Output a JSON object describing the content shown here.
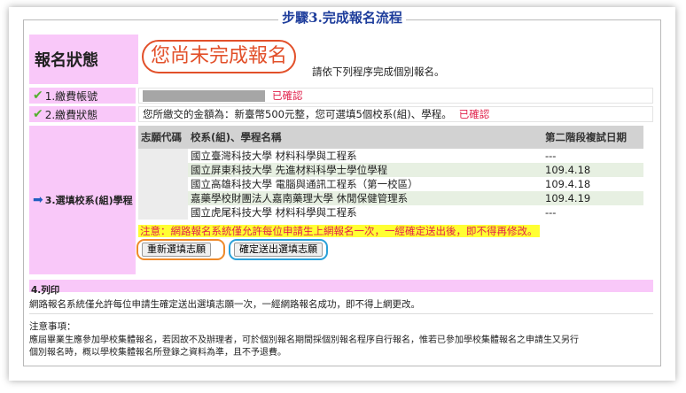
{
  "page": {
    "step_title": "步驟3.完成報名流程"
  },
  "status": {
    "label": "報名狀態",
    "headline": "您尚未完成報名",
    "note": "請依下列程序完成個別報名。"
  },
  "account": {
    "label": "1.繳費帳號",
    "confirmed": "已確認"
  },
  "payment": {
    "label": "2.繳費狀態",
    "text": "您所繳交的金額為：新臺幣500元整，您可選填5個校系(組)、學程。",
    "confirmed": "已確認"
  },
  "choices": {
    "label": "3.選填校系(組)學程",
    "columns": [
      "志願代碼",
      "校系(組)、學程名稱",
      "第二階段複試日期"
    ],
    "rows": [
      {
        "code": "",
        "name": "國立臺灣科技大學 材料科學與工程系",
        "date": "---"
      },
      {
        "code": "",
        "name": "國立屏東科技大學 先進材料科學士學位學程",
        "date": "109.4.18"
      },
      {
        "code": "",
        "name": "國立高雄科技大學 電腦與通訊工程系（第一校區）",
        "date": "109.4.18"
      },
      {
        "code": "",
        "name": "嘉藥學校財團法人嘉南藥理大學 休閒保健管理系",
        "date": "109.4.19"
      },
      {
        "code": "",
        "name": "國立虎尾科技大學 材料科學與工程系",
        "date": "---"
      }
    ],
    "warning": "注意：網路報名系統僅允許每位申請生上網報名一次，一經確定送出後，即不得再修改。",
    "reselect_button": "重新選填志願",
    "confirm_button": "確定送出選填志願"
  },
  "print_section": {
    "label": "4.列印",
    "text": "網路報名系統僅允許每位申請生確定送出選填志願一次，一經網路報名成功，即不得上網更改。"
  },
  "notes": {
    "title": "注意事項：",
    "line1": "應屆畢業生應參加學校集體報名，若因故不及辦理者，可於個別報名期間採個別報名程序自行報名，惟若已參加學校集體報名之申請生又另行",
    "line2": "個別報名時，概以學校集體報名所登錄之資料為準，且不予退費。"
  },
  "colors": {
    "label_bg": "#f9c8f9",
    "title": "#1f3e9c",
    "alert": "#e0204a",
    "highlight": "#ffff33",
    "ring_orange": "#ef8a2a",
    "ring_blue": "#2aa0d8"
  }
}
